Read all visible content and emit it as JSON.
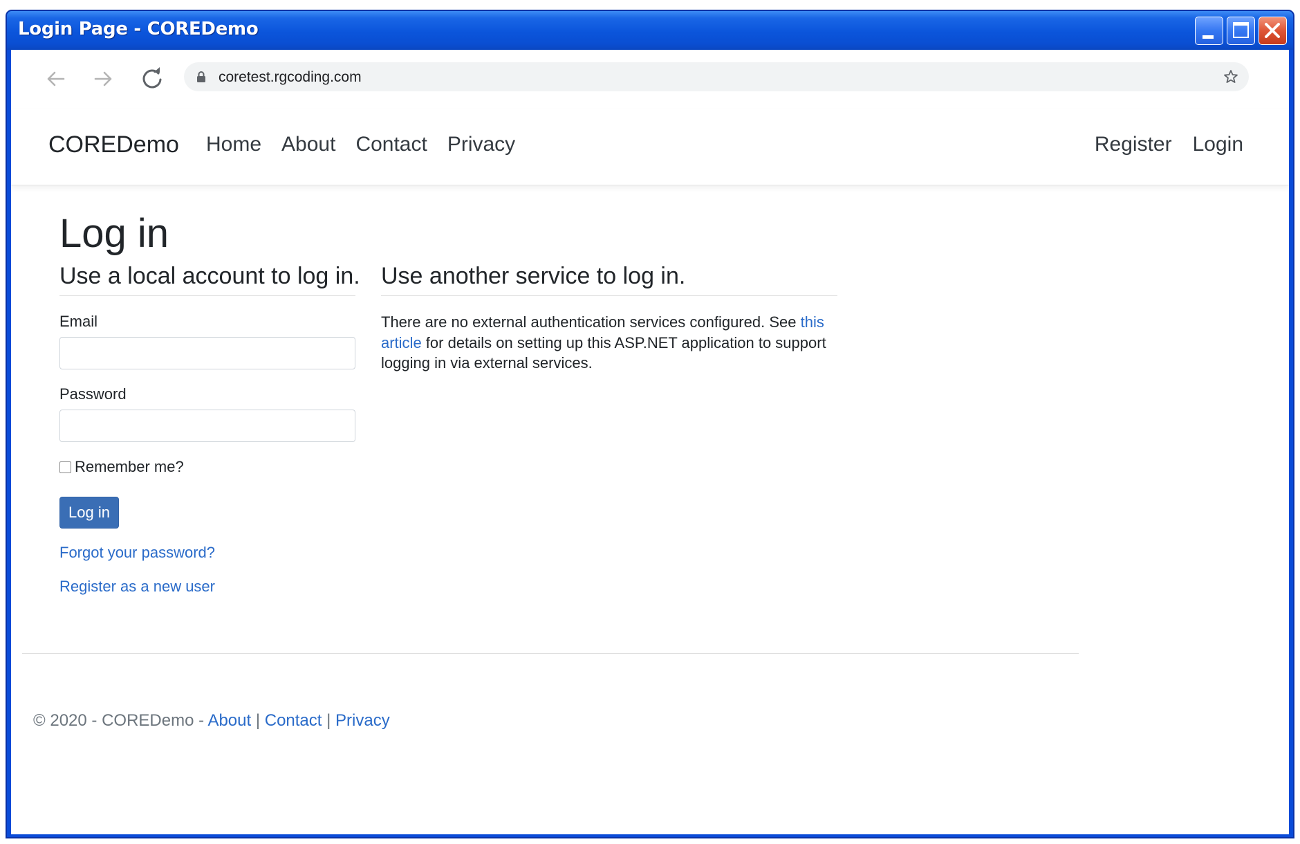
{
  "window": {
    "title": "Login Page - COREDemo"
  },
  "browser": {
    "url": "coretest.rgcoding.com"
  },
  "navbar": {
    "brand": "COREDemo",
    "links": [
      "Home",
      "About",
      "Contact",
      "Privacy"
    ],
    "right_links": [
      "Register",
      "Login"
    ]
  },
  "login": {
    "page_title": "Log in",
    "local_heading": "Use a local account to log in.",
    "email_label": "Email",
    "email_value": "",
    "password_label": "Password",
    "password_value": "",
    "remember_label": "Remember me?",
    "remember_checked": false,
    "submit_label": "Log in",
    "forgot_link": "Forgot your password?",
    "register_link": "Register as a new user"
  },
  "external": {
    "heading": "Use another service to log in.",
    "text_before": "There are no external authentication services configured. See ",
    "link_text": "this article",
    "text_after": " for details on setting up this ASP.NET application to support logging in via external services."
  },
  "footer": {
    "copyright": "© 2020 - COREDemo - ",
    "links": [
      "About",
      "Contact",
      "Privacy"
    ],
    "separator": " | "
  },
  "colors": {
    "link": "#2a6bc9",
    "button": "#3a6eb5",
    "titlebar": "#0a4ed2"
  },
  "icons": [
    "back-arrow-icon",
    "forward-arrow-icon",
    "reload-icon",
    "lock-icon",
    "star-icon",
    "minimize-icon",
    "maximize-icon",
    "close-icon"
  ]
}
